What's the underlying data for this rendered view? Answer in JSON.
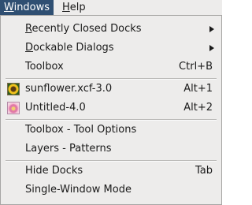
{
  "menubar": {
    "items": [
      {
        "label_mnemonic": "W",
        "label_rest": "indows"
      },
      {
        "label_mnemonic": "H",
        "label_rest": "elp"
      }
    ]
  },
  "menu": {
    "recently_closed_docks": {
      "mnemonic": "R",
      "rest": "ecently Closed Docks"
    },
    "dockable_dialogs": {
      "mnemonic": "D",
      "rest": "ockable Dialogs"
    },
    "toolbox": {
      "label": "Toolbox",
      "shortcut": "Ctrl+B"
    },
    "images": [
      {
        "label": "sunflower.xcf-3.0",
        "shortcut": "Alt+1",
        "icon": "sunflower-thumbnail-icon"
      },
      {
        "label": "Untitled-4.0",
        "shortcut": "Alt+2",
        "icon": "flower-thumbnail-icon"
      }
    ],
    "docks": [
      {
        "label": "Toolbox - Tool Options"
      },
      {
        "label": "Layers - Patterns"
      }
    ],
    "hide_docks": {
      "label": "Hide Docks",
      "shortcut": "Tab"
    },
    "single_window_mode": {
      "label": "Single-Window Mode"
    }
  },
  "colors": {
    "menubar_active_bg": "#2f4f72",
    "menu_bg": "#edeceb",
    "text": "#1a1a1a"
  }
}
